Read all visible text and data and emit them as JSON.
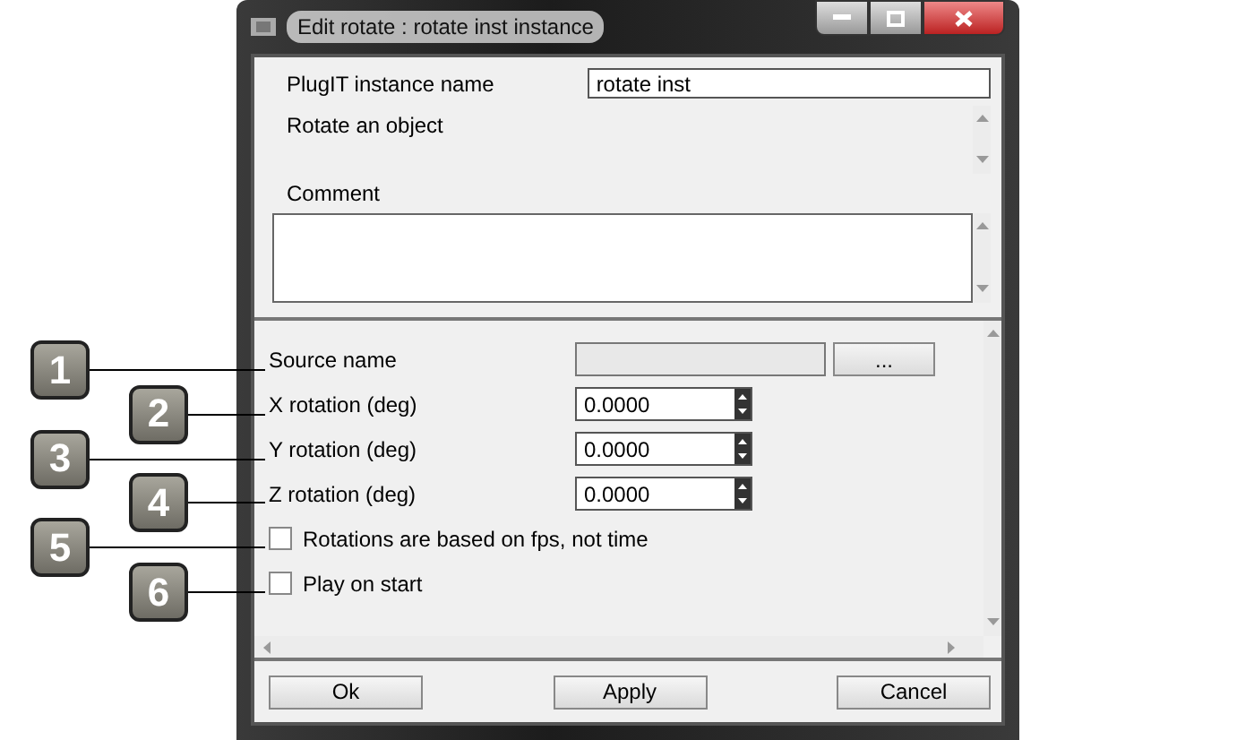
{
  "window": {
    "title": "Edit rotate : rotate inst instance"
  },
  "instance_name": {
    "label": "PlugIT instance name",
    "value": "rotate inst"
  },
  "description": "Rotate an object",
  "comment": {
    "label": "Comment"
  },
  "parameters": [
    {
      "kind": "browse",
      "label": "Source name",
      "button": "..."
    },
    {
      "kind": "spin",
      "label": "X rotation (deg)",
      "value": "0.0000"
    },
    {
      "kind": "spin",
      "label": "Y rotation (deg)",
      "value": "0.0000"
    },
    {
      "kind": "spin",
      "label": "Z rotation (deg)",
      "value": "0.0000"
    },
    {
      "kind": "checkbox",
      "label": "Rotations are based on fps, not time",
      "checked": false
    },
    {
      "kind": "checkbox",
      "label": "Play on start",
      "checked": false
    }
  ],
  "buttons": [
    "Ok",
    "Apply",
    "Cancel"
  ],
  "callouts": [
    "1",
    "2",
    "3",
    "4",
    "5",
    "6"
  ]
}
